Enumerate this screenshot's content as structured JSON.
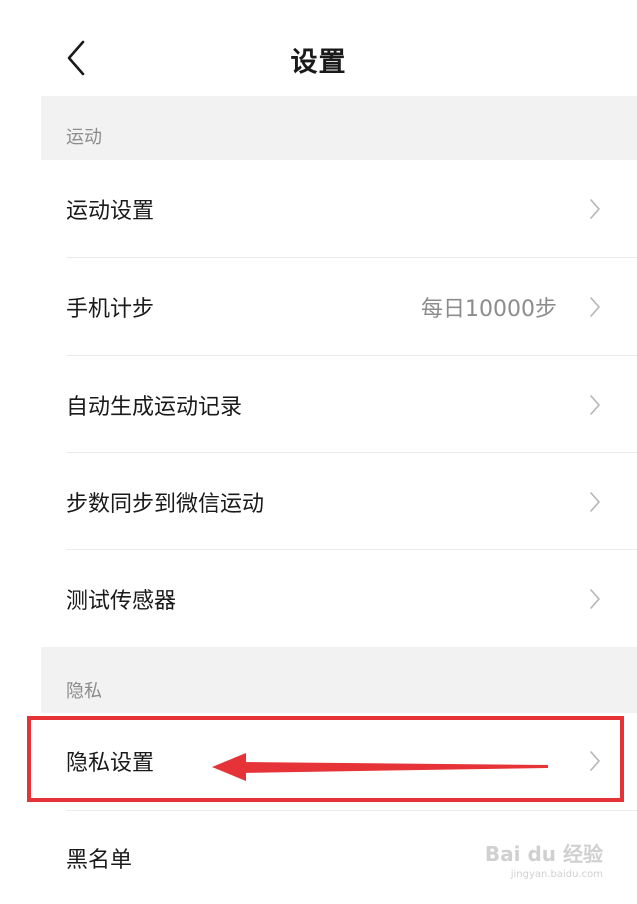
{
  "header": {
    "title": "设置",
    "back_icon": "chevron-left-icon"
  },
  "sections": [
    {
      "title": "运动",
      "rows": [
        {
          "label": "运动设置",
          "value": ""
        },
        {
          "label": "手机计步",
          "value": "每日10000步"
        },
        {
          "label": "自动生成运动记录",
          "value": ""
        },
        {
          "label": "步数同步到微信运动",
          "value": ""
        },
        {
          "label": "测试传感器",
          "value": ""
        }
      ]
    },
    {
      "title": "隐私",
      "rows": [
        {
          "label": "隐私设置",
          "value": ""
        },
        {
          "label": "黑名单",
          "value": ""
        }
      ]
    }
  ],
  "annotation": {
    "color": "#e53338"
  },
  "watermark": {
    "brand": "Bai du 经验",
    "url": "jingyan.baidu.com"
  },
  "colors": {
    "section_bg": "#f2f2f2",
    "text_primary": "#1a1a1a",
    "text_secondary": "#8c8c8c"
  }
}
